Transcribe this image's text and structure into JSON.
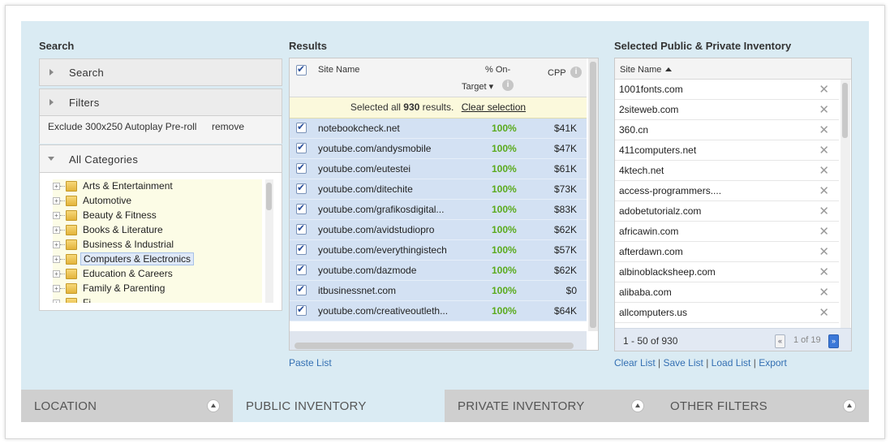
{
  "search_col": {
    "title": "Search",
    "search_accordion": "Search",
    "filters_accordion": "Filters",
    "exclude_text": "Exclude 300x250 Autoplay Pre-roll",
    "remove_label": "remove",
    "categories_header": "All Categories",
    "categories": [
      {
        "label": "Arts & Entertainment",
        "selected": false
      },
      {
        "label": "Automotive",
        "selected": false
      },
      {
        "label": "Beauty & Fitness",
        "selected": false
      },
      {
        "label": "Books & Literature",
        "selected": false
      },
      {
        "label": "Business & Industrial",
        "selected": false
      },
      {
        "label": "Computers & Electronics",
        "selected": true
      },
      {
        "label": "Education & Careers",
        "selected": false
      },
      {
        "label": "Family & Parenting",
        "selected": false
      },
      {
        "label": "Fi...",
        "selected": false
      }
    ]
  },
  "results": {
    "title": "Results",
    "col_site": "Site Name",
    "col_pct_line1": "% On-",
    "col_pct_line2": "Target ▾",
    "col_cpp": "CPP",
    "selected_prefix": "Selected all ",
    "selected_count": "930",
    "selected_suffix": " results.",
    "clear_selection": "Clear selection",
    "rows": [
      {
        "site": "notebookcheck.net",
        "pct": "100%",
        "cpp": "$41K"
      },
      {
        "site": "youtube.com/andysmobile",
        "pct": "100%",
        "cpp": "$47K"
      },
      {
        "site": "youtube.com/eutestei",
        "pct": "100%",
        "cpp": "$61K"
      },
      {
        "site": "youtube.com/ditechite",
        "pct": "100%",
        "cpp": "$73K"
      },
      {
        "site": "youtube.com/grafikosdigital...",
        "pct": "100%",
        "cpp": "$83K"
      },
      {
        "site": "youtube.com/avidstudiopro",
        "pct": "100%",
        "cpp": "$62K"
      },
      {
        "site": "youtube.com/everythingistech",
        "pct": "100%",
        "cpp": "$57K"
      },
      {
        "site": "youtube.com/dazmode",
        "pct": "100%",
        "cpp": "$62K"
      },
      {
        "site": "itbusinessnet.com",
        "pct": "100%",
        "cpp": "$0"
      },
      {
        "site": "youtube.com/creativeoutleth...",
        "pct": "100%",
        "cpp": "$64K"
      }
    ],
    "paste_list": "Paste List"
  },
  "inventory": {
    "title": "Selected Public & Private Inventory",
    "col_site": "Site Name",
    "rows": [
      "1001fonts.com",
      "2siteweb.com",
      "360.cn",
      "411computers.net",
      "4ktech.net",
      "access-programmers....",
      "adobetutorialz.com",
      "africawin.com",
      "afterdawn.com",
      "albinoblacksheep.com",
      "alibaba.com",
      "allcomputers.us"
    ],
    "range": "1 - 50 of 930",
    "page": "1 of 19",
    "links": {
      "clear": "Clear List",
      "save": "Save List",
      "load": "Load List",
      "export": "Export"
    }
  },
  "tabs": [
    {
      "label": "LOCATION",
      "active": false,
      "has_toggle": true
    },
    {
      "label": "PUBLIC INVENTORY",
      "active": true,
      "has_toggle": false
    },
    {
      "label": "PRIVATE INVENTORY",
      "active": false,
      "has_toggle": true
    },
    {
      "label": "OTHER FILTERS",
      "active": false,
      "has_toggle": true
    }
  ],
  "colors": {
    "panel_bg": "#daebf3",
    "row_selected": "#d3e1f3",
    "pct_green": "#5aaa1c",
    "link_blue": "#3470b3"
  }
}
